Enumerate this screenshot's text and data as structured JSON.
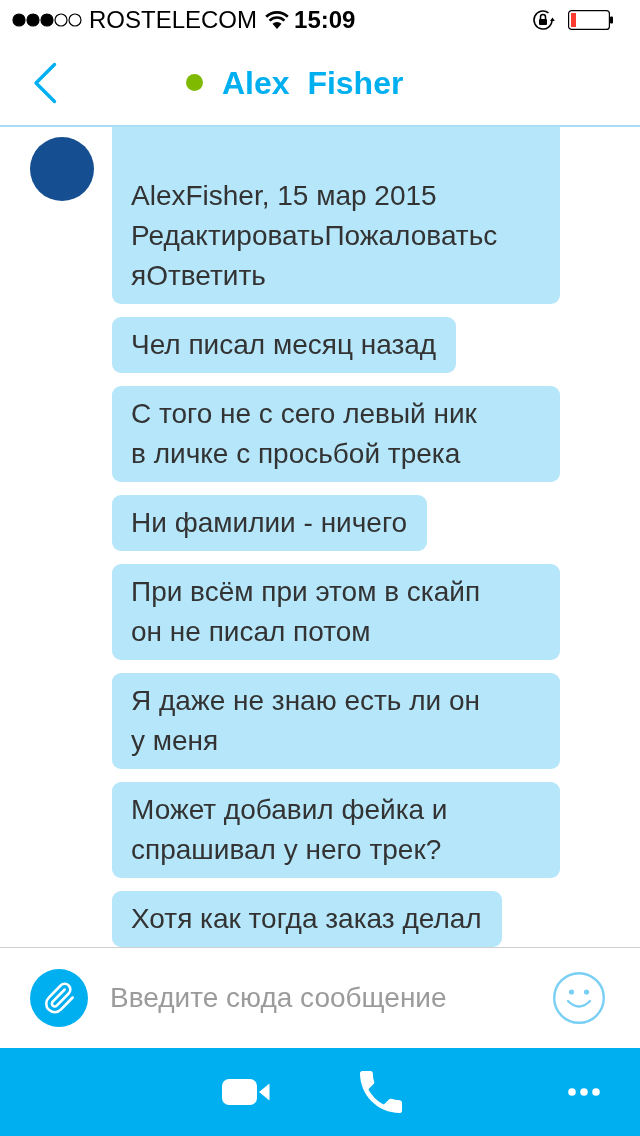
{
  "status_bar": {
    "carrier": "ROSTELECOM",
    "time": "15:09"
  },
  "header": {
    "contact": {
      "name": "Alex  Fisher",
      "online": true
    }
  },
  "messages": [
    {
      "show_avatar": true,
      "lines": [
        "AlexFisher, 15 мар 2015",
        "РедактироватьПожаловатьс",
        "яОтветить"
      ]
    },
    {
      "show_avatar": false,
      "lines": [
        "Чел писал месяц назад"
      ]
    },
    {
      "show_avatar": false,
      "lines": [
        "С того не с сего левый ник",
        "в личке с просьбой трека"
      ]
    },
    {
      "show_avatar": false,
      "lines": [
        "Ни фамилии - ничего"
      ]
    },
    {
      "show_avatar": false,
      "lines": [
        "При всём при этом в скайп",
        "он не писал потом"
      ]
    },
    {
      "show_avatar": false,
      "lines": [
        "Я даже не знаю есть ли он",
        "у меня"
      ]
    },
    {
      "show_avatar": false,
      "lines": [
        "Может добавил фейка и",
        "спрашивал у него трек?"
      ]
    },
    {
      "show_avatar": false,
      "lines": [
        "Хотя как тогда заказ делал"
      ]
    }
  ],
  "composer": {
    "placeholder": "Введите сюда сообщение"
  }
}
